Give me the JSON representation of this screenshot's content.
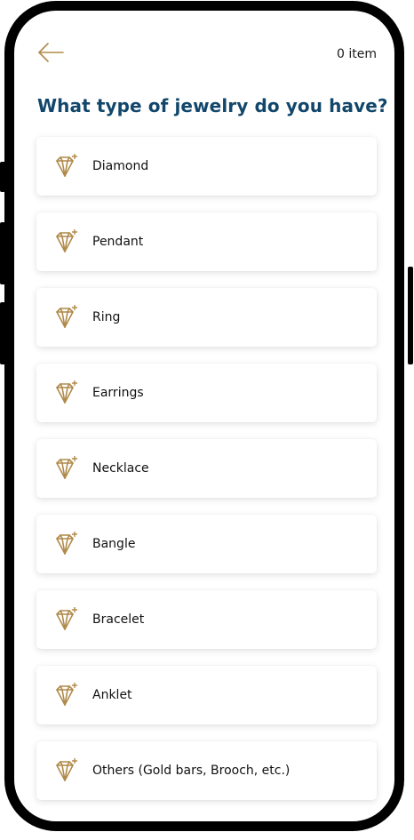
{
  "header": {
    "item_count": "0 item",
    "back_icon": "arrow-left-icon"
  },
  "question": "What type of jewelry do you have?",
  "jewelry_types": [
    {
      "label": "Diamond",
      "icon": "diamond-icon"
    },
    {
      "label": "Pendant",
      "icon": "diamond-icon"
    },
    {
      "label": "Ring",
      "icon": "diamond-icon"
    },
    {
      "label": "Earrings",
      "icon": "diamond-icon"
    },
    {
      "label": "Necklace",
      "icon": "diamond-icon"
    },
    {
      "label": "Bangle",
      "icon": "diamond-icon"
    },
    {
      "label": "Bracelet",
      "icon": "diamond-icon"
    },
    {
      "label": "Anklet",
      "icon": "diamond-icon"
    },
    {
      "label": "Others (Gold bars, Brooch, etc.)",
      "icon": "diamond-icon"
    }
  ],
  "colors": {
    "accent_gold": "#b08a4a",
    "title_blue": "#12476b",
    "frame": "#000000"
  }
}
